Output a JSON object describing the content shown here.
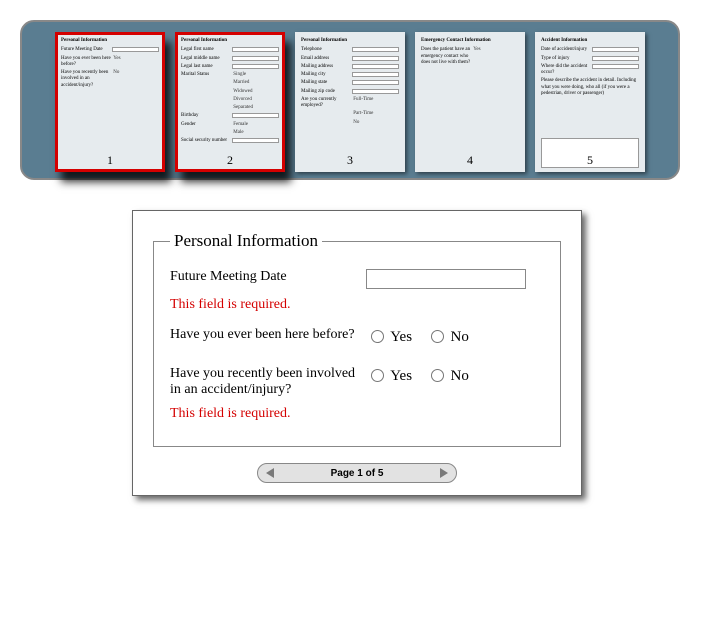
{
  "thumbnails": {
    "count": 5,
    "selected": [
      1,
      2
    ],
    "pages": [
      {
        "number": "1",
        "section": "Personal Information",
        "rows": [
          {
            "label": "Future Meeting Date",
            "kind": "input"
          },
          {
            "label": "Have you ever been here before?",
            "kind": "text",
            "value": "Yes"
          },
          {
            "label": "Have you recently been involved in an accident/injury?",
            "kind": "text",
            "value": "No"
          }
        ]
      },
      {
        "number": "2",
        "section": "Personal Information",
        "rows": [
          {
            "label": "Legal first name",
            "kind": "input"
          },
          {
            "label": "Legal middle name",
            "kind": "input"
          },
          {
            "label": "Legal last name",
            "kind": "input"
          },
          {
            "label": "Marital Status",
            "kind": "text",
            "value": "Single"
          },
          {
            "label": "",
            "kind": "text",
            "value": "Married"
          },
          {
            "label": "",
            "kind": "text",
            "value": "Widowed"
          },
          {
            "label": "",
            "kind": "text",
            "value": "Divorced"
          },
          {
            "label": "",
            "kind": "text",
            "value": "Separated"
          },
          {
            "label": "Birthday",
            "kind": "input"
          },
          {
            "label": "Gender",
            "kind": "text",
            "value": "Female"
          },
          {
            "label": "",
            "kind": "text",
            "value": "Male"
          },
          {
            "label": "Social security number",
            "kind": "input"
          }
        ]
      },
      {
        "number": "3",
        "section": "Personal Information",
        "rows": [
          {
            "label": "Telephone",
            "kind": "input"
          },
          {
            "label": "Email address",
            "kind": "input"
          },
          {
            "label": "Mailing address",
            "kind": "input"
          },
          {
            "label": "Mailing city",
            "kind": "input"
          },
          {
            "label": "Mailing state",
            "kind": "input"
          },
          {
            "label": "Mailing zip code",
            "kind": "input"
          },
          {
            "label": "Are you currently employed?",
            "kind": "text",
            "value": "Full-Time"
          },
          {
            "label": "",
            "kind": "text",
            "value": "Part-Time"
          },
          {
            "label": "",
            "kind": "text",
            "value": "No"
          }
        ]
      },
      {
        "number": "4",
        "section": "Emergency Contact Information",
        "rows": [
          {
            "label": "Does the patient have an emergency contact who does not live with them?",
            "kind": "text",
            "value": "Yes"
          }
        ]
      },
      {
        "number": "5",
        "section": "Accident Information",
        "rows": [
          {
            "label": "Date of accident/injury",
            "kind": "input"
          },
          {
            "label": "Type of injury",
            "kind": "input"
          },
          {
            "label": "Where did the accident occur?",
            "kind": "input"
          },
          {
            "label": "Please describe the accident in detail. Including what you were doing, who all (if you were a pedestrian, driver or passenger)",
            "kind": "textarea"
          }
        ]
      }
    ]
  },
  "form": {
    "legend": "Personal Information",
    "meeting_label": "Future Meeting Date",
    "required_msg": "This field is required.",
    "q1_label": "Have you ever been here before?",
    "q2_label": "Have you recently been involved in an accident/injury?",
    "opt_yes": "Yes",
    "opt_no": "No"
  },
  "pager": {
    "label": "Page 1 of 5"
  }
}
